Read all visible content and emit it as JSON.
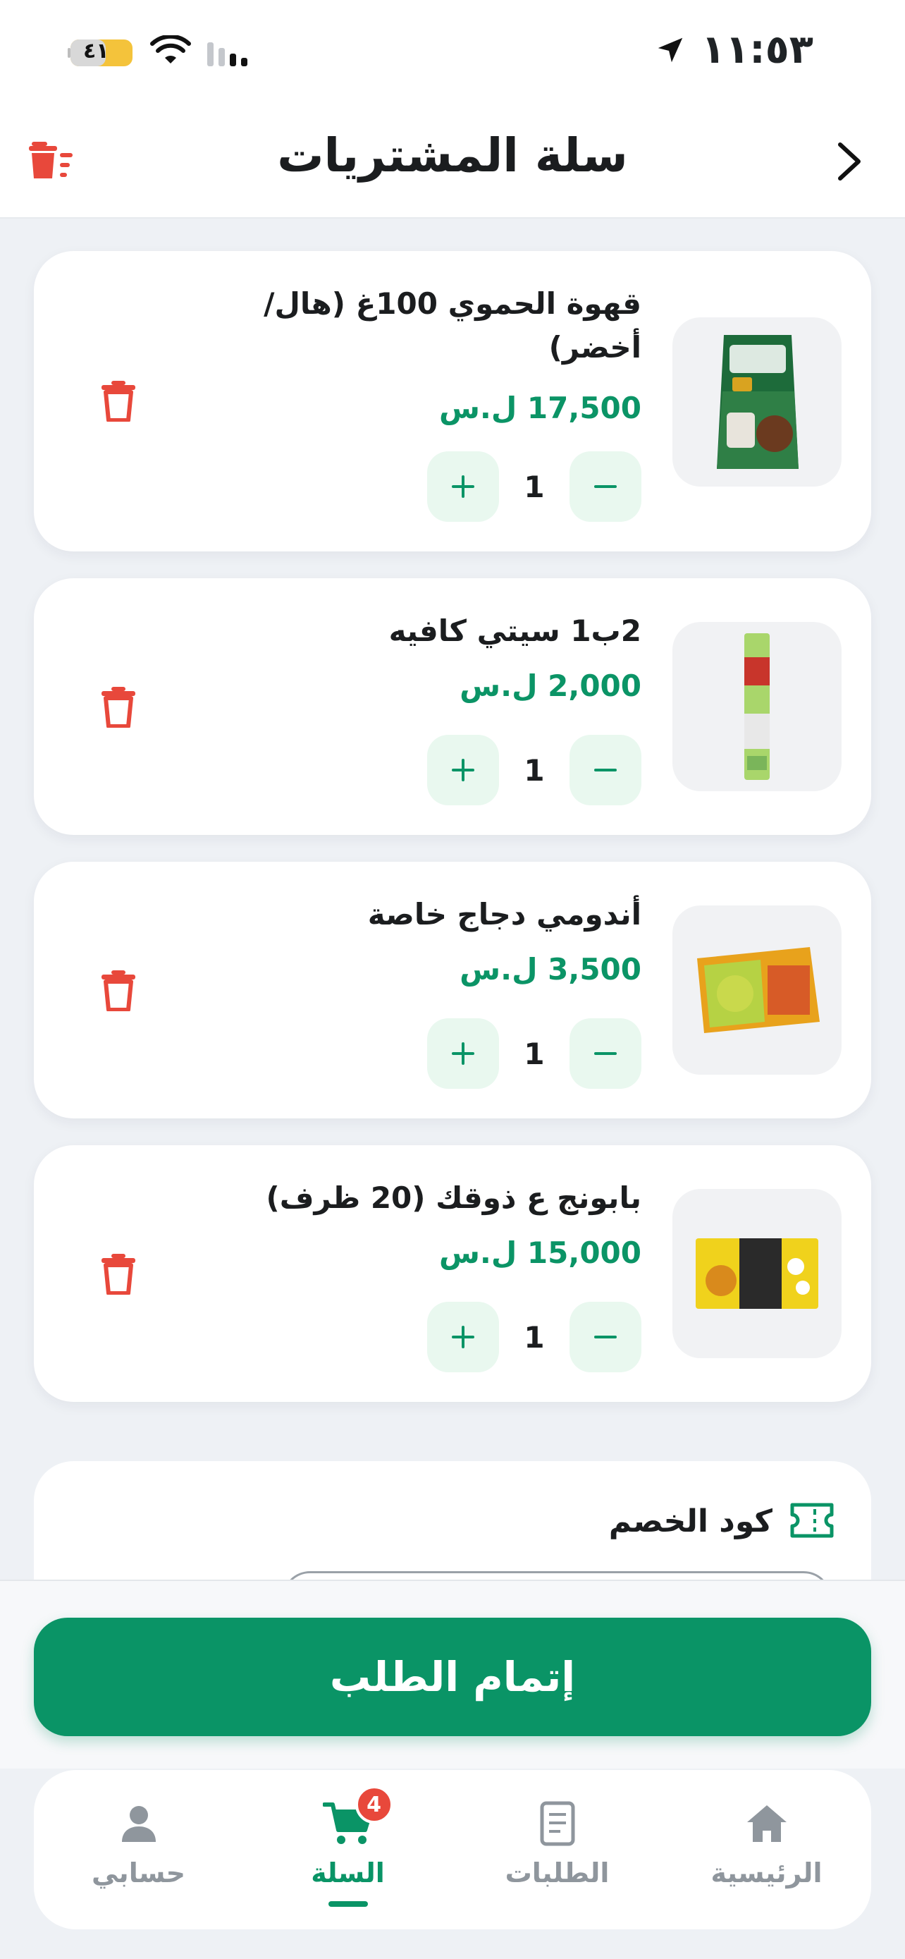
{
  "status_bar": {
    "time": "١١:٥٣",
    "battery_level": "٤١"
  },
  "header": {
    "title": "سلة المشتريات"
  },
  "cart": {
    "items": [
      {
        "name": "قهوة الحموي 100غ (هال/أخضر)",
        "price": "17,500 ل.س",
        "quantity": "1",
        "image": "coffee-bag"
      },
      {
        "name": "2ب1 سيتي كافيه",
        "price": "2,000 ل.س",
        "quantity": "1",
        "image": "coffee-sachet"
      },
      {
        "name": "أندومي دجاج خاصة",
        "price": "3,500 ل.س",
        "quantity": "1",
        "image": "noodles-pack"
      },
      {
        "name": "بابونج ع ذوقك (20 ظرف)",
        "price": "15,000 ل.س",
        "quantity": "1",
        "image": "tea-box"
      }
    ]
  },
  "coupon": {
    "title": "كود الخصم"
  },
  "checkout": {
    "button_label": "إتمام الطلب"
  },
  "bottom_nav": {
    "items": [
      {
        "label": "الرئيسية",
        "icon": "home-icon",
        "active": false
      },
      {
        "label": "الطلبات",
        "icon": "orders-icon",
        "active": false
      },
      {
        "label": "السلة",
        "icon": "cart-icon",
        "active": true,
        "badge": "4"
      },
      {
        "label": "حسابي",
        "icon": "profile-icon",
        "active": false
      }
    ]
  },
  "colors": {
    "primary": "#0a9466",
    "danger": "#e8483b",
    "background": "#eef1f5"
  }
}
